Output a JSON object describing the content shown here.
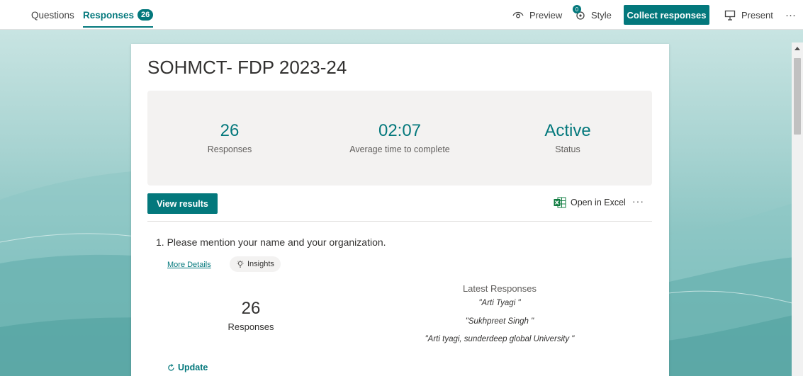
{
  "tabs": [
    {
      "label": "Questions"
    },
    {
      "label": "Responses",
      "badge": "26"
    }
  ],
  "toolbar": {
    "preview": "Preview",
    "style": "Style",
    "style_badge": "0",
    "collect": "Collect responses",
    "present": "Present",
    "more": "···"
  },
  "form": {
    "title": "SOHMCT- FDP 2023-24",
    "stats": [
      {
        "value": "26",
        "label": "Responses"
      },
      {
        "value": "02:07",
        "label": "Average time to complete"
      },
      {
        "value": "Active",
        "label": "Status"
      }
    ],
    "view_results": "View results",
    "open_excel": "Open in Excel",
    "more": "···"
  },
  "question": {
    "text": "1. Please mention your name and your organization.",
    "more_details": "More Details",
    "insights": "Insights",
    "responses_count": "26",
    "responses_label": "Responses",
    "latest_title": "Latest Responses",
    "latest": [
      "\"Arti Tyagi \"",
      "\"Sukhpreet Singh \"",
      "\"Arti tyagi, sunderdeep global University \""
    ],
    "update": "Update"
  },
  "colors": {
    "accent": "#03787c",
    "background_top": "#c8e4e2",
    "background_bottom": "#6ab3b1"
  },
  "icons": [
    "preview-icon",
    "style-icon",
    "present-icon",
    "excel-icon",
    "lightbulb-icon",
    "refresh-icon"
  ]
}
